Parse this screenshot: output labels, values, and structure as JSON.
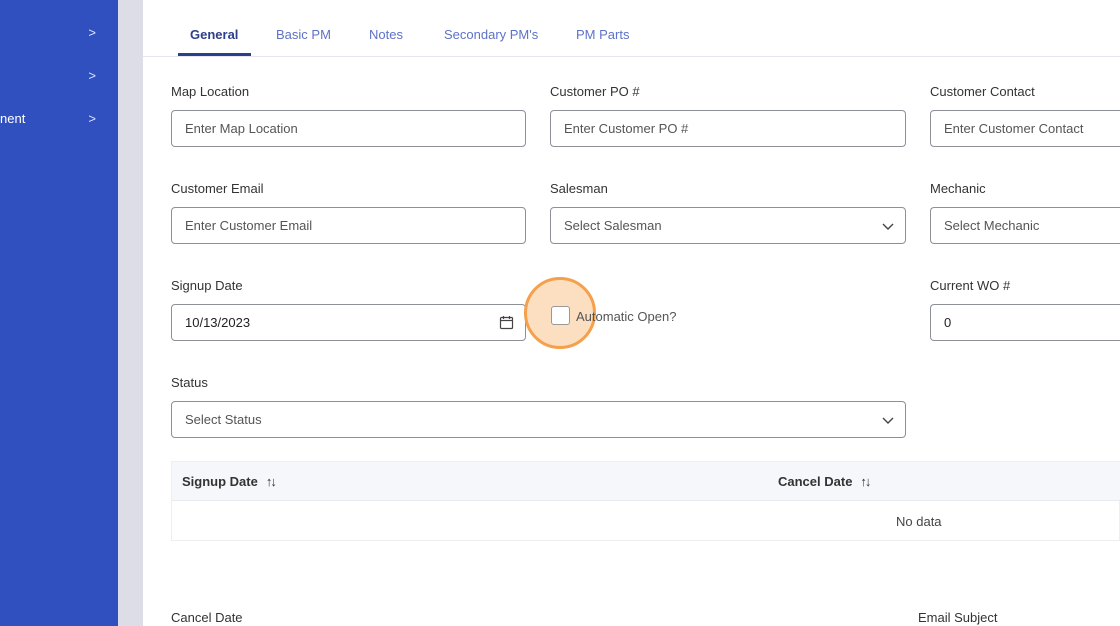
{
  "sidebar": {
    "items": [
      {
        "label": "",
        "chevron": ">"
      },
      {
        "label": "",
        "chevron": ">"
      },
      {
        "label": "nent",
        "chevron": ">"
      }
    ]
  },
  "tabs": [
    {
      "label": "General",
      "active": true
    },
    {
      "label": "Basic PM",
      "active": false
    },
    {
      "label": "Notes",
      "active": false
    },
    {
      "label": "Secondary PM's",
      "active": false
    },
    {
      "label": "PM Parts",
      "active": false
    }
  ],
  "form": {
    "map_location": {
      "label": "Map Location",
      "placeholder": "Enter Map Location"
    },
    "customer_po": {
      "label": "Customer PO #",
      "placeholder": "Enter Customer PO #"
    },
    "customer_contact": {
      "label": "Customer Contact",
      "placeholder": "Enter Customer Contact"
    },
    "customer_email": {
      "label": "Customer Email",
      "placeholder": "Enter Customer Email"
    },
    "salesman": {
      "label": "Salesman",
      "placeholder": "Select Salesman"
    },
    "mechanic": {
      "label": "Mechanic",
      "placeholder": "Select Mechanic"
    },
    "signup_date": {
      "label": "Signup Date",
      "value": "10/13/2023"
    },
    "automatic_open": {
      "label": "Automatic Open?",
      "checked": false
    },
    "current_wo": {
      "label": "Current WO #",
      "value": "0"
    },
    "status": {
      "label": "Status",
      "placeholder": "Select Status"
    },
    "cancel_date": {
      "label": "Cancel Date"
    },
    "email_subject": {
      "label": "Email Subject"
    }
  },
  "table": {
    "columns": [
      "Signup Date",
      "Cancel Date"
    ],
    "sort_icon": "↑↓",
    "empty_text": "No data"
  },
  "colors": {
    "sidebar": "#3050c0",
    "tab_active": "#2c3e8c",
    "tab_inactive": "#5e72c8",
    "highlight": "#f5a04c"
  }
}
